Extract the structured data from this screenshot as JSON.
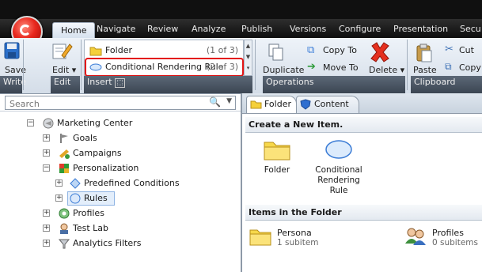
{
  "ribbon": {
    "tabs": [
      "Home",
      "Navigate",
      "Review",
      "Analyze",
      "Publish",
      "Versions",
      "Configure",
      "Presentation",
      "Secu"
    ],
    "active_tab": "Home",
    "save_label": "Save",
    "edit_label": "Edit",
    "write_group": "Write",
    "edit_group": "Edit",
    "insert_group": "Insert",
    "insert_items": [
      {
        "label": "Folder",
        "count": "(1 of 3)"
      },
      {
        "label": "Conditional Rendering Rule",
        "count": "(2 of 3)"
      }
    ],
    "duplicate_label": "Duplicate",
    "copy_to_label": "Copy To",
    "move_to_label": "Move To",
    "delete_label": "Delete",
    "operations_group": "Operations",
    "paste_label": "Paste",
    "cut_label": "Cut",
    "copy_label": "Copy",
    "clipboard_group": "Clipboard"
  },
  "search": {
    "placeholder": "Search"
  },
  "tree": [
    {
      "label": "Marketing Center",
      "expander": "−",
      "icon": "marketing-center-icon"
    },
    {
      "label": "Goals",
      "expander": "+",
      "icon": "flag-icon"
    },
    {
      "label": "Campaigns",
      "expander": "+",
      "icon": "campaign-icon"
    },
    {
      "label": "Personalization",
      "expander": "−",
      "icon": "personalization-icon"
    },
    {
      "label": "Predefined Conditions",
      "expander": "+",
      "icon": "condition-icon"
    },
    {
      "label": "Rules",
      "expander": "+",
      "icon": "rule-icon"
    },
    {
      "label": "Profiles",
      "expander": "+",
      "icon": "profiles-icon"
    },
    {
      "label": "Test Lab",
      "expander": "+",
      "icon": "test-lab-icon"
    },
    {
      "label": "Analytics Filters",
      "expander": "+",
      "icon": "filter-icon"
    }
  ],
  "right": {
    "tabs": [
      "Folder",
      "Content"
    ],
    "create_heading": "Create a New Item.",
    "create_items": [
      {
        "label": "Folder"
      },
      {
        "label": "Conditional Rendering Rule"
      }
    ],
    "folder_heading": "Items in the Folder",
    "folder_items": [
      {
        "name": "Persona",
        "sub": "1 subitem"
      },
      {
        "name": "Profiles",
        "sub": "0 subitems"
      }
    ]
  }
}
